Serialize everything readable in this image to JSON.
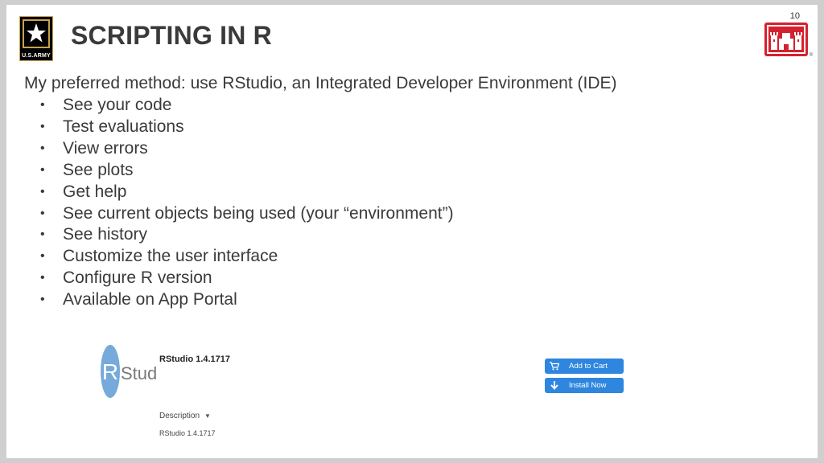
{
  "slide": {
    "page_number": "10",
    "title": "SCRIPTING IN R",
    "army_logo_text": "U.S.ARMY",
    "intro": "My preferred method: use RStudio, an Integrated Developer Environment (IDE)",
    "bullets": [
      "See your code",
      "Test evaluations",
      "View errors",
      "See plots",
      "Get help",
      "See current objects being used (your “environment”)",
      "See history",
      "Customize the user interface",
      "Configure R version",
      "Available on App Portal"
    ]
  },
  "app_portal": {
    "app_name": "RStudio 1.4.1717",
    "logo_text": "Studio",
    "description_label": "Description",
    "description_value": "RStudio 1.4.1717",
    "add_to_cart_label": "Add to Cart",
    "install_now_label": "Install Now"
  },
  "colors": {
    "title": "#3a3a3a",
    "button": "#2e86de",
    "castle_red": "#d5212f",
    "rstudio_blue": "#75aadb",
    "army_gold": "#caa34a"
  },
  "icons": {
    "cart": "cart-icon",
    "install": "download-arrow-icon",
    "dropdown": "chevron-down-icon"
  }
}
